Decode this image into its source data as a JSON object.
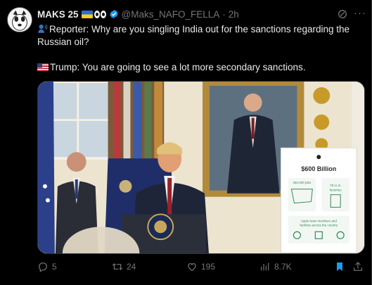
{
  "author": {
    "name": "MAKS 25",
    "handle": "@Maks_NAFO_FELLA",
    "separator": "·",
    "time": "2h"
  },
  "tweet": {
    "line1": "Reporter: Why are you singling India out for the sanctions regarding the Russian oil?",
    "line2": "Trump: You are going to see a lot more secondary sanctions."
  },
  "media": {
    "sign_amount": "$600 Billion",
    "sign_jobs": "450,000 jobs",
    "sign_factories_num": "79 U.S.",
    "sign_factories_label": "factories",
    "sign_footer_1": "Apple team members and",
    "sign_footer_2": "facilities across the country"
  },
  "actions": {
    "replies": "5",
    "retweets": "24",
    "likes": "195",
    "views": "8.7K"
  },
  "colors": {
    "background": "#000000",
    "text": "#e7e9ea",
    "muted": "#71767b",
    "verified": "#1d9bf0",
    "bookmark": "#1d9bf0"
  },
  "icons": [
    "avatar",
    "ukraine-flag",
    "eyes-emoji",
    "verified-badge",
    "grok-icon",
    "more-icon",
    "speaker-icon",
    "us-flag",
    "reply-icon",
    "retweet-icon",
    "like-icon",
    "views-icon",
    "bookmark-icon",
    "share-icon"
  ]
}
